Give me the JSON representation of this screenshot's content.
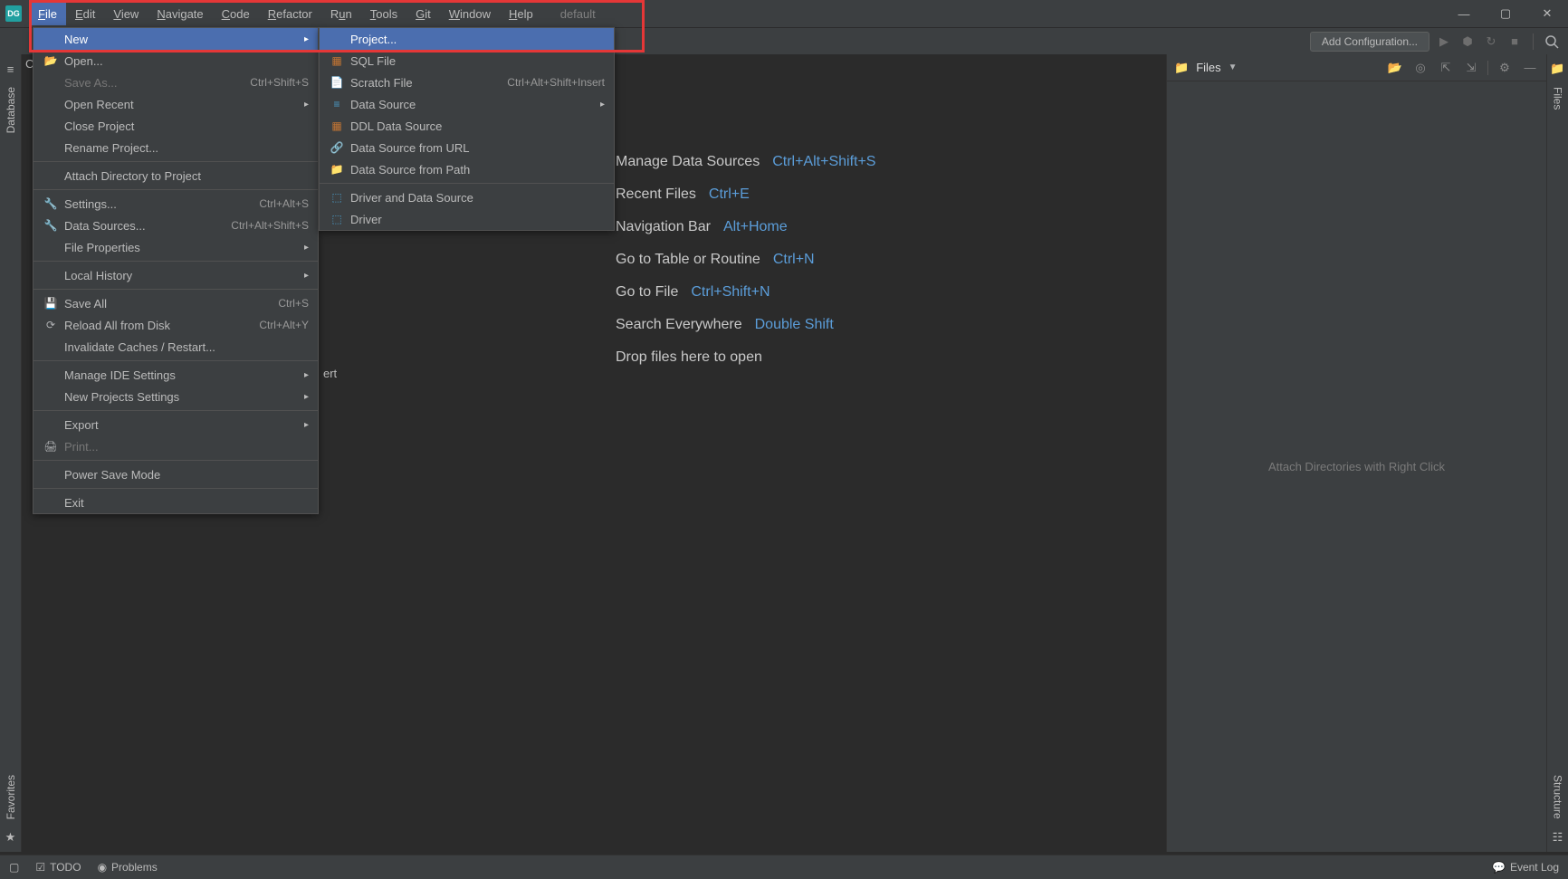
{
  "app_icon": "DG",
  "menubar": [
    "File",
    "Edit",
    "View",
    "Navigate",
    "Code",
    "Refactor",
    "Run",
    "Tools",
    "Git",
    "Window",
    "Help"
  ],
  "project_label": "default",
  "toolbar": {
    "config": "Add Configuration..."
  },
  "file_menu": {
    "new": "New",
    "open": "Open...",
    "save_as": "Save As...",
    "save_as_sc": "Ctrl+Shift+S",
    "open_recent": "Open Recent",
    "close_project": "Close Project",
    "rename_project": "Rename Project...",
    "attach_dir": "Attach Directory to Project",
    "settings": "Settings...",
    "settings_sc": "Ctrl+Alt+S",
    "data_sources": "Data Sources...",
    "data_sources_sc": "Ctrl+Alt+Shift+S",
    "file_properties": "File Properties",
    "local_history": "Local History",
    "save_all": "Save All",
    "save_all_sc": "Ctrl+S",
    "reload": "Reload All from Disk",
    "reload_sc": "Ctrl+Alt+Y",
    "invalidate": "Invalidate Caches / Restart...",
    "manage_ide": "Manage IDE Settings",
    "new_proj_settings": "New Projects Settings",
    "export": "Export",
    "print": "Print...",
    "power_save": "Power Save Mode",
    "exit": "Exit"
  },
  "new_submenu": {
    "project": "Project...",
    "sql_file": "SQL File",
    "scratch_file": "Scratch File",
    "scratch_sc": "Ctrl+Alt+Shift+Insert",
    "data_source": "Data Source",
    "ddl_ds": "DDL Data Source",
    "ds_url": "Data Source from URL",
    "ds_path": "Data Source from Path",
    "driver_ds": "Driver and Data Source",
    "driver": "Driver"
  },
  "welcome": [
    {
      "text": "Manage Data Sources",
      "sc": "Ctrl+Alt+Shift+S"
    },
    {
      "text": "Recent Files",
      "sc": "Ctrl+E"
    },
    {
      "text": "Navigation Bar",
      "sc": "Alt+Home"
    },
    {
      "text": "Go to Table or Routine",
      "sc": "Ctrl+N"
    },
    {
      "text": "Go to File",
      "sc": "Ctrl+Shift+N"
    },
    {
      "text": "Search Everywhere",
      "sc": "Double Shift"
    },
    {
      "text": "Drop files here to open",
      "sc": ""
    }
  ],
  "files_panel": {
    "title": "Files",
    "hint": "Attach Directories with Right Click"
  },
  "left_rail": {
    "database": "Database",
    "favorites": "Favorites"
  },
  "right_rail": {
    "files": "Files",
    "structure": "Structure"
  },
  "status": {
    "todo": "TODO",
    "problems": "Problems",
    "eventlog": "Event Log"
  },
  "behind_text": "ert",
  "behind_prefix": "C"
}
